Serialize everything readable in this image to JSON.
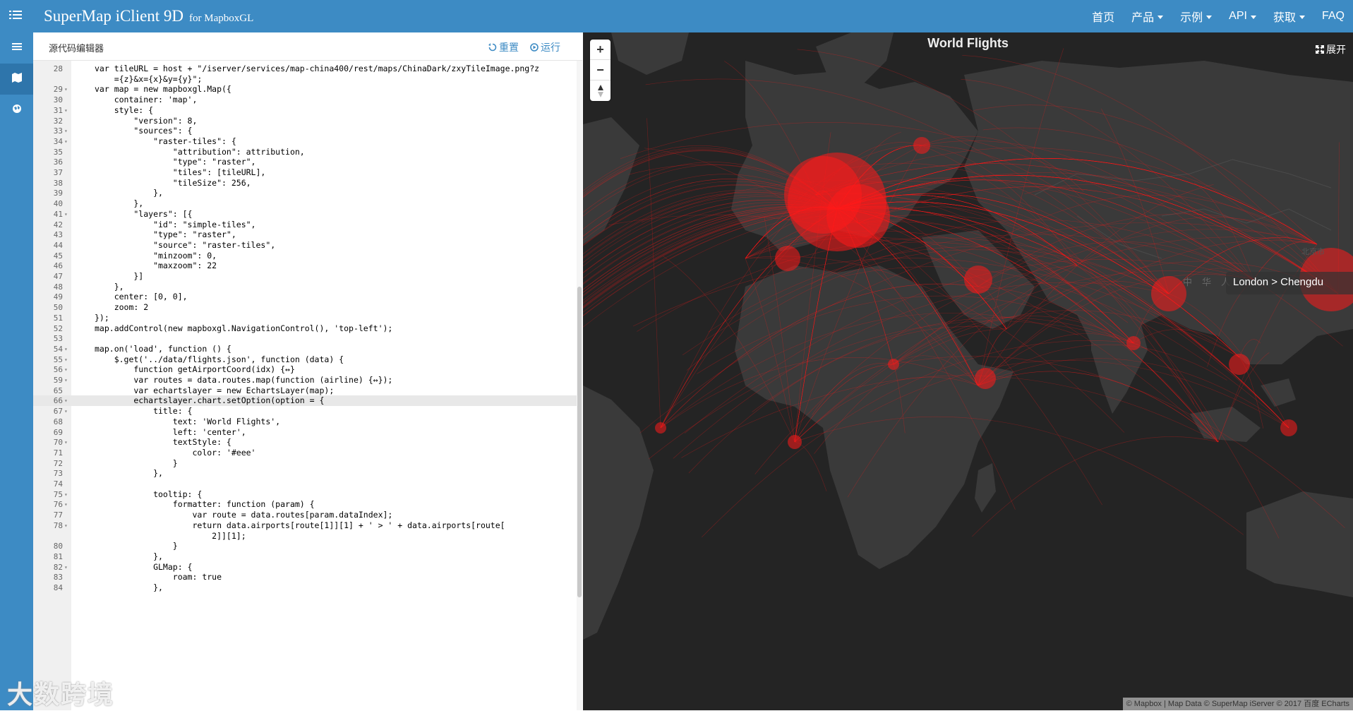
{
  "app": {
    "brand": "SuperMap iClient 9D",
    "brand_sub": "for MapboxGL"
  },
  "topnav": [
    {
      "label": "首页",
      "dropdown": false
    },
    {
      "label": "产品",
      "dropdown": true
    },
    {
      "label": "示例",
      "dropdown": true
    },
    {
      "label": "API",
      "dropdown": true
    },
    {
      "label": "获取",
      "dropdown": true
    },
    {
      "label": "FAQ",
      "dropdown": false
    }
  ],
  "sidenav": [
    {
      "icon": "list-icon",
      "active": false
    },
    {
      "icon": "map-icon",
      "active": true
    },
    {
      "icon": "globe-icon",
      "active": false
    }
  ],
  "editor": {
    "title": "源代码编辑器",
    "reset_label": "重置",
    "run_label": "运行",
    "lines": [
      {
        "n": "28",
        "fold": false,
        "text": "var tileURL = host + \"/iserver/services/map-china400/rest/maps/ChinaDark/zxyTileImage.png?z"
      },
      {
        "n": "",
        "fold": false,
        "text": "    ={z}&x={x}&y={y}\";"
      },
      {
        "n": "29",
        "fold": true,
        "text": "var map = new mapboxgl.Map({"
      },
      {
        "n": "30",
        "fold": false,
        "text": "    container: 'map',"
      },
      {
        "n": "31",
        "fold": true,
        "text": "    style: {"
      },
      {
        "n": "32",
        "fold": false,
        "text": "        \"version\": 8,"
      },
      {
        "n": "33",
        "fold": true,
        "text": "        \"sources\": {"
      },
      {
        "n": "34",
        "fold": true,
        "text": "            \"raster-tiles\": {"
      },
      {
        "n": "35",
        "fold": false,
        "text": "                \"attribution\": attribution,"
      },
      {
        "n": "36",
        "fold": false,
        "text": "                \"type\": \"raster\","
      },
      {
        "n": "37",
        "fold": false,
        "text": "                \"tiles\": [tileURL],"
      },
      {
        "n": "38",
        "fold": false,
        "text": "                \"tileSize\": 256,"
      },
      {
        "n": "39",
        "fold": false,
        "text": "            },"
      },
      {
        "n": "40",
        "fold": false,
        "text": "        },"
      },
      {
        "n": "41",
        "fold": true,
        "text": "        \"layers\": [{"
      },
      {
        "n": "42",
        "fold": false,
        "text": "            \"id\": \"simple-tiles\","
      },
      {
        "n": "43",
        "fold": false,
        "text": "            \"type\": \"raster\","
      },
      {
        "n": "44",
        "fold": false,
        "text": "            \"source\": \"raster-tiles\","
      },
      {
        "n": "45",
        "fold": false,
        "text": "            \"minzoom\": 0,"
      },
      {
        "n": "46",
        "fold": false,
        "text": "            \"maxzoom\": 22"
      },
      {
        "n": "47",
        "fold": false,
        "text": "        }]"
      },
      {
        "n": "48",
        "fold": false,
        "text": "    },"
      },
      {
        "n": "49",
        "fold": false,
        "text": "    center: [0, 0],"
      },
      {
        "n": "50",
        "fold": false,
        "text": "    zoom: 2"
      },
      {
        "n": "51",
        "fold": false,
        "text": "});"
      },
      {
        "n": "52",
        "fold": false,
        "text": "map.addControl(new mapboxgl.NavigationControl(), 'top-left');"
      },
      {
        "n": "53",
        "fold": false,
        "text": ""
      },
      {
        "n": "54",
        "fold": true,
        "text": "map.on('load', function () {"
      },
      {
        "n": "55",
        "fold": true,
        "text": "    $.get('../data/flights.json', function (data) {"
      },
      {
        "n": "56",
        "fold": true,
        "text": "        function getAirportCoord(idx) {↔}"
      },
      {
        "n": "59",
        "fold": true,
        "text": "        var routes = data.routes.map(function (airline) {↔});"
      },
      {
        "n": "65",
        "fold": false,
        "text": "        var echartslayer = new EchartsLayer(map);"
      },
      {
        "n": "66",
        "fold": true,
        "text": "        echartslayer.chart.setOption(option = {",
        "active": true
      },
      {
        "n": "67",
        "fold": true,
        "text": "            title: {"
      },
      {
        "n": "68",
        "fold": false,
        "text": "                text: 'World Flights',"
      },
      {
        "n": "69",
        "fold": false,
        "text": "                left: 'center',"
      },
      {
        "n": "70",
        "fold": true,
        "text": "                textStyle: {"
      },
      {
        "n": "71",
        "fold": false,
        "text": "                    color: '#eee'"
      },
      {
        "n": "72",
        "fold": false,
        "text": "                }"
      },
      {
        "n": "73",
        "fold": false,
        "text": "            },"
      },
      {
        "n": "74",
        "fold": false,
        "text": ""
      },
      {
        "n": "75",
        "fold": true,
        "text": "            tooltip: {"
      },
      {
        "n": "76",
        "fold": true,
        "text": "                formatter: function (param) {"
      },
      {
        "n": "77",
        "fold": false,
        "text": "                    var route = data.routes[param.dataIndex];"
      },
      {
        "n": "78",
        "fold": true,
        "text": "                    return data.airports[route[1]][1] + ' > ' + data.airports[route["
      },
      {
        "n": "",
        "fold": false,
        "text": "                        2]][1];"
      },
      {
        "n": "80",
        "fold": false,
        "text": "                }"
      },
      {
        "n": "81",
        "fold": false,
        "text": "            },"
      },
      {
        "n": "82",
        "fold": true,
        "text": "            GLMap: {"
      },
      {
        "n": "83",
        "fold": false,
        "text": "                roam: true"
      },
      {
        "n": "84",
        "fold": false,
        "text": "            },"
      }
    ]
  },
  "map": {
    "title": "World Flights",
    "expand_label": "展开",
    "tooltip": "London > Chengdu",
    "label_beijing": "北京市",
    "label_china": "中华人",
    "attribution": "© Mapbox | Map Data © SuperMap iServer © 2017 百度 ECharts"
  },
  "watermark": "大数跨境",
  "colors": {
    "nav_bg": "#3d8bc4",
    "map_bg": "#242424",
    "flight_line": "#ff1a1a"
  }
}
